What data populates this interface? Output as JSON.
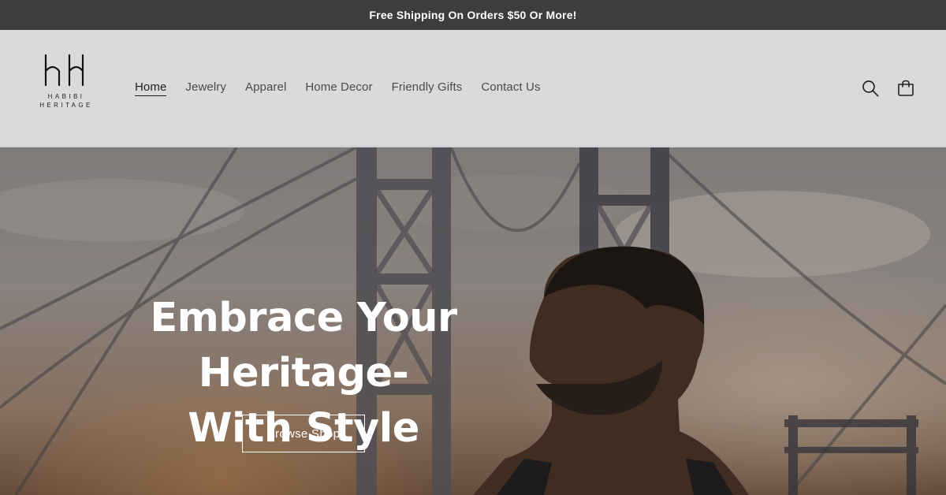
{
  "announcement": {
    "text": "Free Shipping On Orders $50 Or More!"
  },
  "brand": {
    "line1": "HABIBI",
    "line2": "HERITAGE"
  },
  "nav": {
    "items": [
      {
        "label": "Home",
        "active": true
      },
      {
        "label": "Jewelry"
      },
      {
        "label": "Apparel"
      },
      {
        "label": "Home Decor"
      },
      {
        "label": "Friendly Gifts"
      },
      {
        "label": "Contact Us"
      }
    ]
  },
  "header_icons": {
    "search": "search-icon",
    "cart": "cart-icon"
  },
  "hero": {
    "title_line1": "Embrace Your Heritage-",
    "title_line2": "With Style",
    "button_label": "Browse Shop"
  },
  "colors": {
    "announcement_bg": "#3d3d3d",
    "header_bg": "#d9dadb",
    "text_dark": "#1f1f1f",
    "text_nav": "#4b4b4b",
    "hero_text": "#ffffff"
  }
}
